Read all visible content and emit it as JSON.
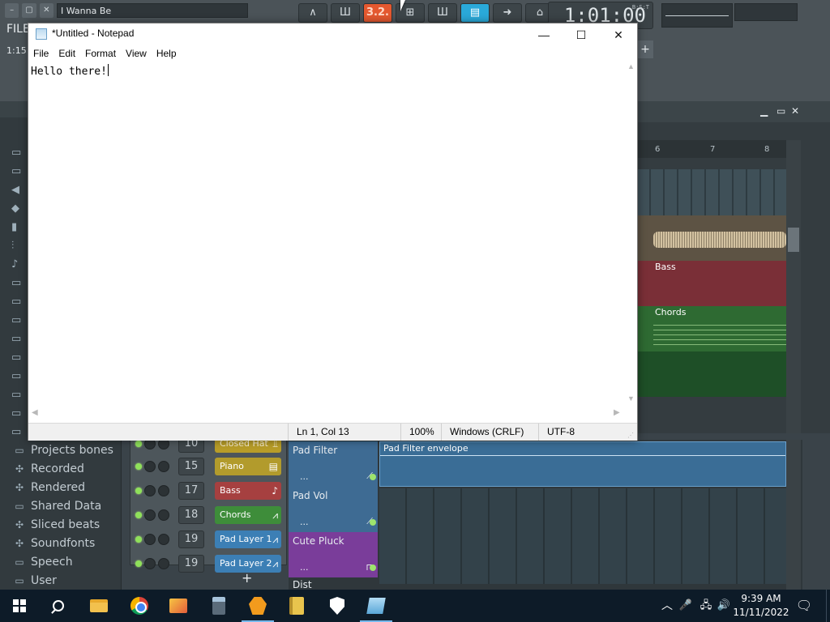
{
  "fl_studio": {
    "song_title": "I Wanna Be",
    "menu_file": "FILE",
    "time_small": "1:15",
    "toolbar": {
      "btn1": "∧",
      "btn2": "Ш",
      "pattern_num": "3.2.",
      "btn4": "⊞",
      "btn5": "Ш",
      "btn6": "▤",
      "btn7": "➜",
      "btn8": "⌂"
    },
    "clock_main": "1:01:00",
    "clock_label": "B:S:T",
    "add_symbol": "+",
    "accent_orange": "#e4582f",
    "accent_blue": "#2aa9d9",
    "browser": {
      "items": [
        {
          "label": "Projects bones",
          "icon": "folder-icon",
          "glyph": "▭"
        },
        {
          "label": "Recorded",
          "icon": "recorded-icon",
          "glyph": "✣"
        },
        {
          "label": "Rendered",
          "icon": "rendered-icon",
          "glyph": "✣"
        },
        {
          "label": "Shared Data",
          "icon": "folder-icon",
          "glyph": "▭"
        },
        {
          "label": "Sliced beats",
          "icon": "sliced-icon",
          "glyph": "✣"
        },
        {
          "label": "Soundfonts",
          "icon": "soundfont-icon",
          "glyph": "✣"
        },
        {
          "label": "Speech",
          "icon": "folder-icon",
          "glyph": "▭"
        },
        {
          "label": "User",
          "icon": "folder-icon",
          "glyph": "▭"
        }
      ]
    },
    "channel_rack": {
      "rows": [
        {
          "num": "10",
          "name": "Closed Hat",
          "glyph": "⫫"
        },
        {
          "num": "15",
          "name": "Piano",
          "glyph": "▤"
        },
        {
          "num": "17",
          "name": "Bass",
          "glyph": "♪"
        },
        {
          "num": "18",
          "name": "Chords",
          "glyph": "⩘"
        },
        {
          "num": "19",
          "name": "Pad Layer 1",
          "glyph": "⩘"
        },
        {
          "num": "19",
          "name": "Pad Layer 2",
          "glyph": "⩘"
        }
      ],
      "add_label": "+"
    },
    "playlist": {
      "ruler": [
        "6",
        "7",
        "8"
      ],
      "clip_bass": "Bass",
      "clip_chords": "Chords"
    },
    "automation": {
      "tracks": [
        {
          "name": "Pad Filter",
          "more": "..."
        },
        {
          "name": "Pad Vol",
          "more": "..."
        },
        {
          "name": "Cute Pluck",
          "more": "..."
        }
      ],
      "clip_label": "Pad Filter envelope",
      "bottom_cut": "Dist"
    }
  },
  "notepad": {
    "title": "*Untitled - Notepad",
    "menu": [
      "File",
      "Edit",
      "Format",
      "View",
      "Help"
    ],
    "text": "Hello there!",
    "status": {
      "position": "Ln 1, Col 13",
      "zoom": "100%",
      "line_ending": "Windows (CRLF)",
      "encoding": "UTF-8"
    },
    "caption_minimize": "—",
    "caption_maximize": "☐",
    "caption_close": "✕"
  },
  "taskbar": {
    "time": "9:39 AM",
    "date": "11/11/2022",
    "tray": {
      "chevron": "︿",
      "mic": "🎤",
      "network": "🖧",
      "volume": "🔊",
      "notifications": "🗨"
    }
  }
}
